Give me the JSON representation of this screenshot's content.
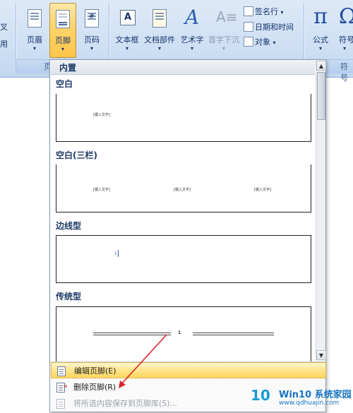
{
  "ribbon": {
    "partial_left_label_1": "叉",
    "partial_left_label_2": "用",
    "buttons": {
      "header": "页眉",
      "footer": "页脚",
      "page_number": "页码",
      "text_box": "文本框",
      "quick_parts": "文档部件",
      "wordart": "艺术字",
      "drop_cap": "首字下沉",
      "signature_line": "签名行",
      "date_time": "日期和时间",
      "object": "对象",
      "equation": "公式",
      "symbol": "符号"
    },
    "group_labels": {
      "header_footer_partial": "页",
      "symbols_partial": "符号"
    },
    "active_color": "#ffd36b"
  },
  "gallery": {
    "header": "内置",
    "sections": [
      {
        "title": "空白",
        "placeholders": [
          "[键入文字]"
        ]
      },
      {
        "title": "空白(三栏)",
        "placeholders": [
          "[键入文字]",
          "[键入文字]",
          "[键入文字]"
        ]
      },
      {
        "title": "边线型",
        "placeholders": [
          "1"
        ]
      },
      {
        "title": "传统型",
        "placeholders": [
          "1"
        ]
      }
    ]
  },
  "menu": {
    "edit_footer": "编辑页脚(E)",
    "remove_footer": "删除页脚(R)",
    "save_to_gallery": "将所选内容保存到页脚库(S)...",
    "highlight_color": "#ffe48a"
  },
  "watermark": {
    "logo": "10",
    "brand": "Win10 系统家园",
    "url": "www.qdhuajin.com"
  },
  "annotation": {
    "arrow_color": "#d9262b"
  }
}
